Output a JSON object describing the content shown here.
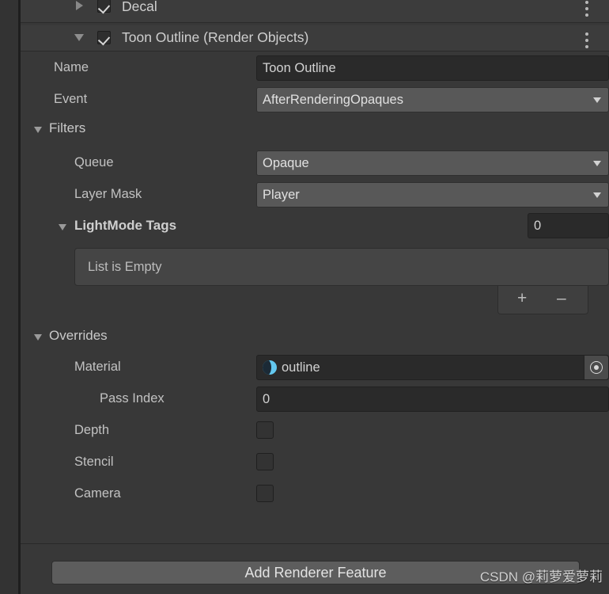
{
  "window": {
    "type": "unity-inspector-render-objects"
  },
  "features": [
    {
      "title": "Decal",
      "enabled": true,
      "expanded": false,
      "foldout_icon": "triangle-right-icon",
      "checkbox_icon": "checkmark-icon",
      "menu_icon": "kebab-menu-icon"
    },
    {
      "title": "Toon Outline (Render Objects)",
      "enabled": true,
      "expanded": true,
      "foldout_icon": "triangle-down-icon",
      "checkbox_icon": "checkmark-icon",
      "menu_icon": "kebab-menu-icon"
    }
  ],
  "fields": {
    "name_label": "Name",
    "name_value": "Toon Outline",
    "event_label": "Event",
    "event_value": "AfterRenderingOpaques",
    "event_dropdown_icon": "chevron-down-icon"
  },
  "filters": {
    "section_label": "Filters",
    "foldout_icon": "triangle-down-icon",
    "queue_label": "Queue",
    "queue_value": "Opaque",
    "queue_dropdown_icon": "chevron-down-icon",
    "layer_mask_label": "Layer Mask",
    "layer_mask_value": "Player",
    "layer_mask_dropdown_icon": "chevron-down-icon",
    "lightmode_label": "LightMode Tags",
    "lightmode_foldout_icon": "triangle-down-icon",
    "lightmode_size": "0",
    "list_empty_text": "List is Empty",
    "add_item_label": "+",
    "remove_item_label": "–",
    "add_item_icon": "plus-icon",
    "remove_item_icon": "minus-icon"
  },
  "overrides": {
    "section_label": "Overrides",
    "foldout_icon": "triangle-down-icon",
    "material_label": "Material",
    "material_value": "outline",
    "material_icon": "material-sphere-icon",
    "material_picker_icon": "object-picker-icon",
    "pass_index_label": "Pass Index",
    "pass_index_value": "0",
    "depth_label": "Depth",
    "depth_checked": false,
    "stencil_label": "Stencil",
    "stencil_checked": false,
    "camera_label": "Camera",
    "camera_checked": false
  },
  "footer": {
    "add_renderer_feature_label": "Add Renderer Feature"
  },
  "watermark": {
    "text": "CSDN @莉萝爱萝莉"
  },
  "colors": {
    "panel_bg": "#383838",
    "header_bg": "#3c3c3c",
    "field_bg": "#2a2a2a",
    "popup_bg": "#585858",
    "accent_material": "#63c8ef",
    "text": "#c4c4c4"
  }
}
